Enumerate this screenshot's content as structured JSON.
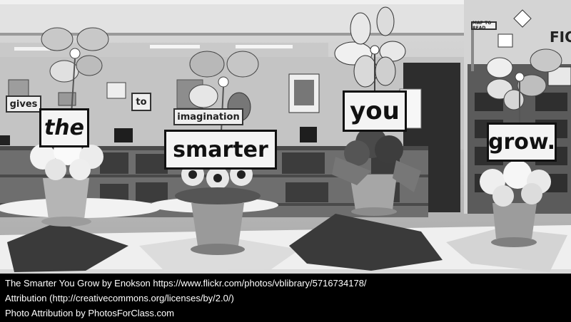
{
  "photo": {
    "signs": {
      "the": "the",
      "smarter": "smarter",
      "you": "you",
      "grow": "grow.",
      "gives": "gives",
      "to": "to",
      "imagination": "imagination"
    },
    "wall_signs": {
      "map_to_read": "MAP TO READ",
      "fic": "FICTI"
    }
  },
  "credits": {
    "line1": "The Smarter You Grow by Enokson https://www.flickr.com/photos/vblibrary/5716734178/",
    "line2": "Attribution (http://creativecommons.org/licenses/by/2.0/)",
    "line3": "Photo Attribution by PhotosForClass.com"
  }
}
